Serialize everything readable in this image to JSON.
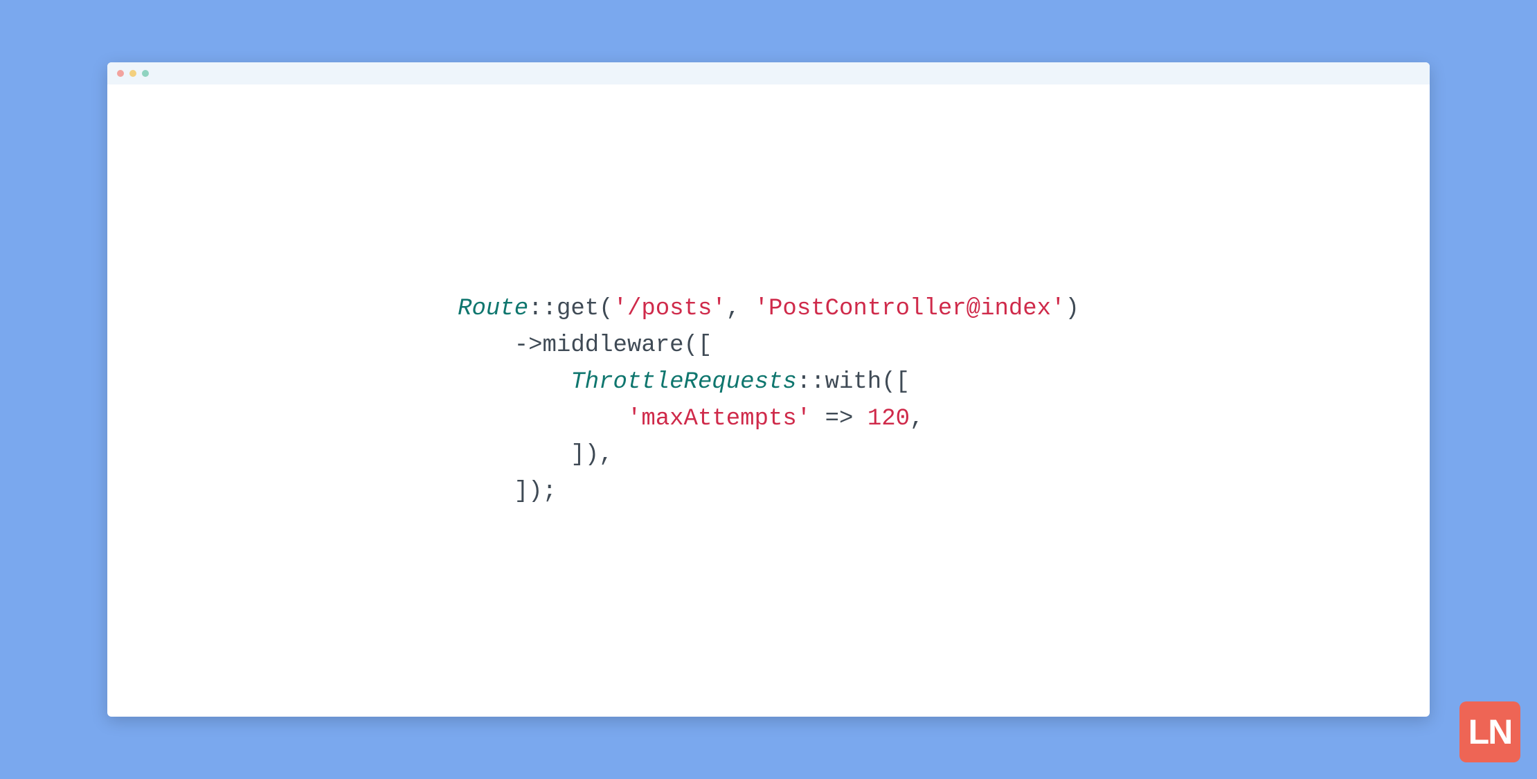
{
  "logo": {
    "text": "LN"
  },
  "code": {
    "line1": {
      "class": "Route",
      "sep": "::",
      "method": "get",
      "open": "(",
      "arg1": "'/posts'",
      "comma": ", ",
      "arg2": "'PostController@index'",
      "close": ")"
    },
    "line2": {
      "indent": "    ",
      "arrow": "->",
      "method": "middleware",
      "open": "(["
    },
    "line3": {
      "indent": "        ",
      "class": "ThrottleRequests",
      "sep": "::",
      "method": "with",
      "open": "(["
    },
    "line4": {
      "indent": "            ",
      "key": "'maxAttempts'",
      "arrow": " => ",
      "value": "120",
      "comma": ","
    },
    "line5": {
      "indent": "        ",
      "close": "]),"
    },
    "line6": {
      "indent": "    ",
      "close": "]);"
    }
  }
}
